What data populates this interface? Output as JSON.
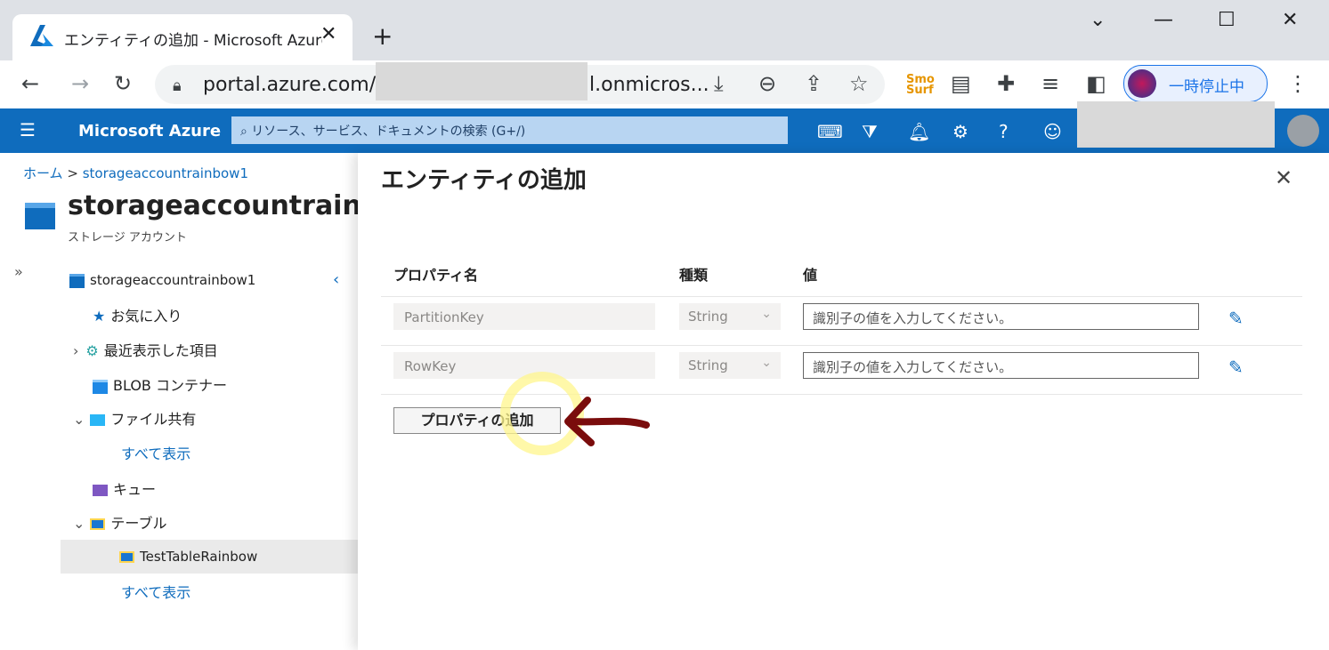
{
  "browser": {
    "tab_title": "エンティティの追加 - Microsoft Azure",
    "url_prefix": "portal.azure.com/#@",
    "url_suffix": "l.onmicros...",
    "profile_label": "一時停止中"
  },
  "azure": {
    "brand": "Microsoft Azure",
    "search_placeholder": "リソース、サービス、ドキュメントの検索 (G+/)"
  },
  "blade": {
    "breadcrumb_home": "ホーム",
    "breadcrumb_sep": ">",
    "breadcrumb_resource": "storageaccountrainbow1",
    "resource_name": "storageaccountrainbow1",
    "resource_type": "ストレージ アカウント",
    "nav": [
      {
        "label": "storageaccountrainbow1"
      },
      {
        "label": "お気に入り"
      },
      {
        "label": "最近表示した項目"
      },
      {
        "label": "BLOB コンテナー"
      },
      {
        "label": "ファイル共有"
      },
      {
        "label": "すべて表示"
      },
      {
        "label": "キュー"
      },
      {
        "label": "テーブル"
      },
      {
        "label": "TestTableRainbow"
      },
      {
        "label": "すべて表示"
      }
    ]
  },
  "panel": {
    "title": "エンティティの追加",
    "columns": {
      "name": "プロパティ名",
      "type": "種類",
      "value": "値"
    },
    "rows": [
      {
        "name": "PartitionKey",
        "type": "String",
        "value_placeholder": "識別子の値を入力してください。"
      },
      {
        "name": "RowKey",
        "type": "String",
        "value_placeholder": "識別子の値を入力してください。"
      }
    ],
    "add_property_label": "プロパティの追加"
  },
  "colors": {
    "azure_blue": "#0f6cbd",
    "highlight": "#fff58c",
    "annotation_arrow": "#7a0c0c"
  }
}
